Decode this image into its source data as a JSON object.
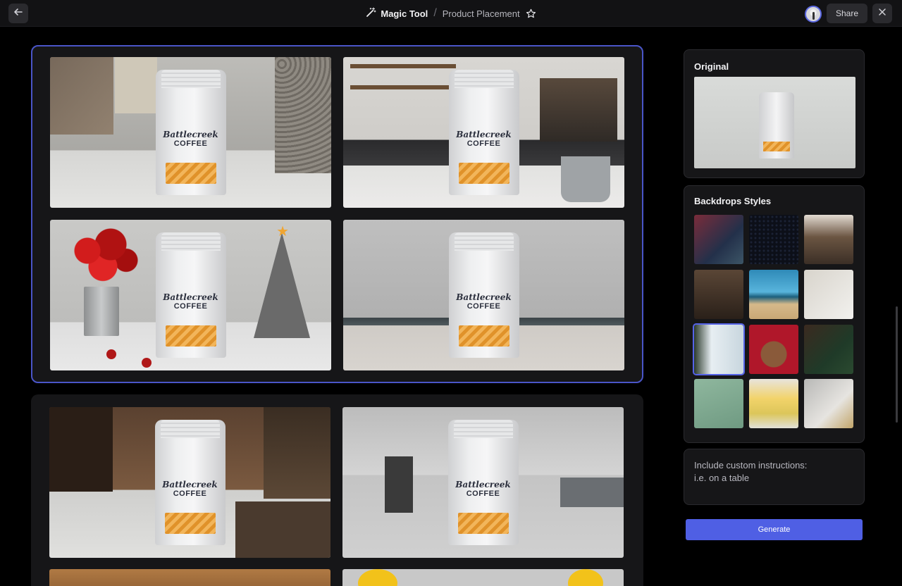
{
  "header": {
    "tool_name": "Magic Tool",
    "separator": "/",
    "page_name": "Product Placement",
    "share_label": "Share"
  },
  "icons": {
    "back": "arrow-left-icon",
    "tool": "magic-wand-icon",
    "favorite": "star-icon",
    "close": "close-icon"
  },
  "product": {
    "brand_script": "Battlecreek",
    "brand_word": "COFFEE"
  },
  "results": {
    "groups": [
      {
        "selected": true,
        "images": [
          "Gray room with decorated walls",
          "Coffee bar with mug",
          "Christmas scene with red flowers and tree",
          "Gray beach"
        ]
      },
      {
        "selected": false,
        "images": [
          "Cafe counter",
          "Modern office",
          "Warm interior",
          "Yellow balloons"
        ]
      }
    ]
  },
  "sidebar": {
    "original_title": "Original",
    "backdrops_title": "Backdrops Styles",
    "selected_backdrop_index": 6,
    "custom_instructions_line1": "Include custom instructions:",
    "custom_instructions_line2": "i.e. on a table",
    "generate_label": "Generate"
  },
  "colors": {
    "accent": "#4f5fe4",
    "selection_border": "#4a55c8",
    "panel_bg": "#161618",
    "page_bg": "#000000"
  }
}
